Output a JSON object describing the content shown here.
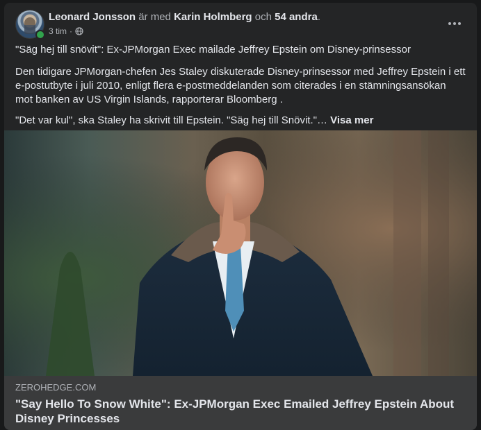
{
  "post": {
    "author": "Leonard Jonsson",
    "with_text": "är med",
    "tagged_person": "Karin Holmberg",
    "and_text": "och",
    "others": "54 andra",
    "period": ".",
    "timestamp": "3 tim",
    "separator": "·",
    "audience_icon": "globe-icon",
    "more_icon": "more-options-icon",
    "headline": "\"Säg hej till snövit\": Ex-JPMorgan Exec mailade Jeffrey Epstein om Disney-prinsessor",
    "body": "Den tidigare JPMorgan-chefen Jes Staley diskuterade Disney-prinsessor med Jeffrey Epstein i ett e-postutbyte i juli 2010, enligt flera e-postmeddelanden som citerades i en stämningsansökan mot banken av US Virgin Islands, rapporterar Bloomberg .",
    "quote": "\"Det var kul\", ska Staley ha skrivit till Epstein. \"Säg hej till Snövit.\"… ",
    "see_more": "Visa mer"
  },
  "link_preview": {
    "domain": "ZEROHEDGE.COM",
    "title": "\"Say Hello To Snow White\": Ex-JPMorgan Exec Emailed Jeffrey Epstein About Disney Princesses"
  },
  "colors": {
    "background": "#18191a",
    "card": "#242526",
    "link_footer": "#3a3b3c",
    "primary_text": "#e4e6eb",
    "secondary_text": "#b0b3b8",
    "online": "#31a24c"
  }
}
